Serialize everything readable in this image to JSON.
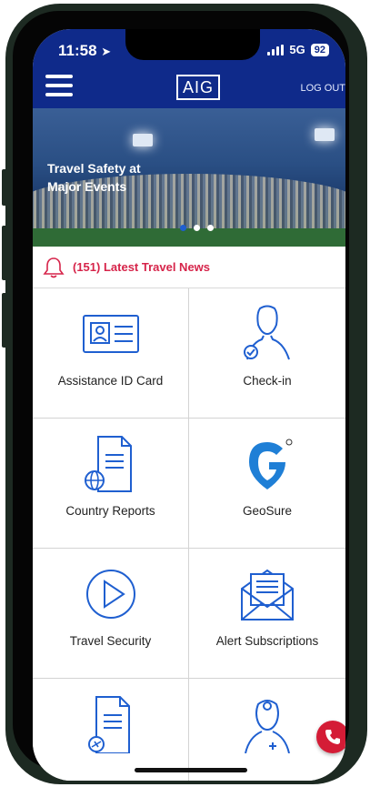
{
  "status_bar": {
    "time": "11:58",
    "network": "5G",
    "battery": "92"
  },
  "header": {
    "logo": "AIG",
    "logout": "LOG OUT"
  },
  "banner": {
    "title": "Travel Safety at Major Events",
    "slide_count": 3,
    "active_slide": 0
  },
  "news": {
    "label": "(151) Latest Travel News"
  },
  "tiles": [
    {
      "label": "Assistance ID Card",
      "icon": "id-card-icon"
    },
    {
      "label": "Check-in",
      "icon": "person-check-icon"
    },
    {
      "label": "Country Reports",
      "icon": "document-globe-icon"
    },
    {
      "label": "GeoSure",
      "icon": "geosure-logo-icon"
    },
    {
      "label": "Travel Security",
      "icon": "play-circle-icon"
    },
    {
      "label": "Alert Subscriptions",
      "icon": "envelope-document-icon"
    },
    {
      "label": "",
      "icon": "document-airplane-icon"
    },
    {
      "label": "",
      "icon": "doctor-icon"
    }
  ],
  "colors": {
    "brand_blue": "#0f2a8a",
    "accent_red": "#d6244a",
    "icon_blue": "#1f5fd0"
  }
}
